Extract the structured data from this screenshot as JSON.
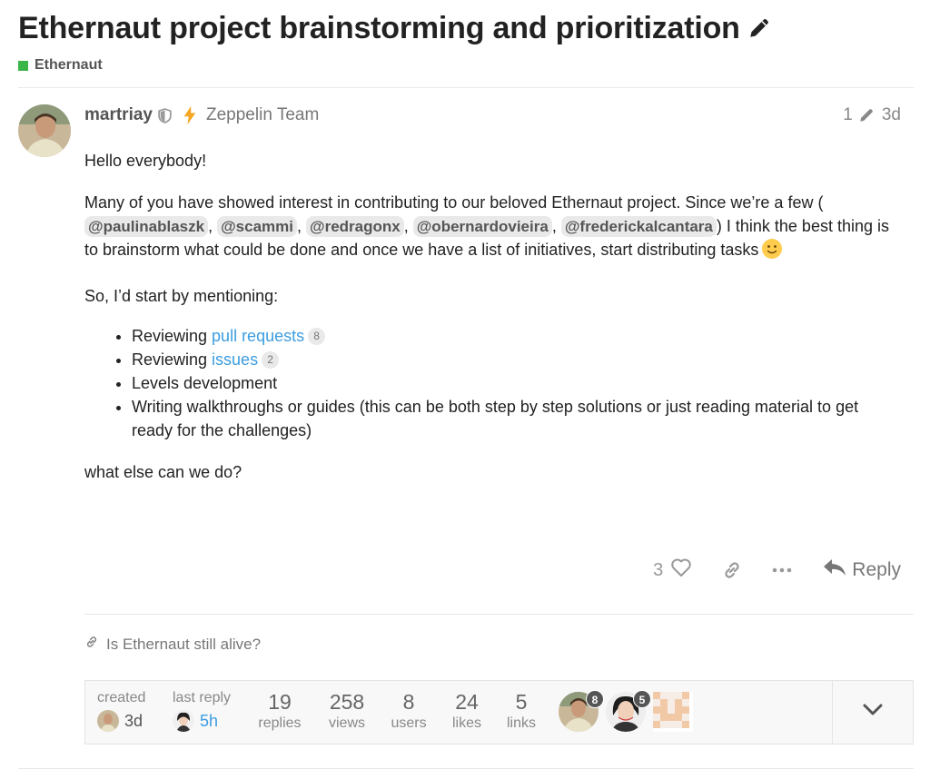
{
  "topic": {
    "title": "Ethernaut project brainstorming and prioritization",
    "category": "Ethernaut",
    "category_color": "#3ab54a"
  },
  "post": {
    "username": "martriay",
    "group": "Zeppelin Team",
    "edit_count": "1",
    "age": "3d",
    "greeting": "Hello everybody!",
    "intro_before": "Many of you have showed interest in contributing to our beloved Ethernaut project. Since we’re a few (",
    "mentions": [
      "@paulinablaszk",
      "@scammi",
      "@redragonx",
      "@obernardovieira",
      "@frederickalcantara"
    ],
    "intro_after": ") I think the best thing is to brainstorm what could be done and once we have a list of initiatives, start distributing tasks",
    "start_text": "So, I’d start by mentioning:",
    "list": [
      {
        "prefix": "Reviewing ",
        "link": "pull requests",
        "count": "8"
      },
      {
        "prefix": "Reviewing ",
        "link": "issues",
        "count": "2"
      },
      {
        "text": "Levels development"
      },
      {
        "text": "Writing walkthroughs or guides (this can be both step by step solutions or just reading material to get ready for the challenges)"
      }
    ],
    "closing": "what else can we do?",
    "likes": "3",
    "reply_label": "Reply"
  },
  "linked_topic": "Is Ethernaut still alive?",
  "summary": {
    "created_label": "created",
    "created_value": "3d",
    "last_reply_label": "last reply",
    "last_reply_value": "5h",
    "stats": [
      {
        "num": "19",
        "label": "replies"
      },
      {
        "num": "258",
        "label": "views"
      },
      {
        "num": "8",
        "label": "users"
      },
      {
        "num": "24",
        "label": "likes"
      },
      {
        "num": "5",
        "label": "links"
      }
    ],
    "participants": [
      {
        "badge": "8"
      },
      {
        "badge": "5"
      },
      {
        "badge": ""
      }
    ]
  },
  "colors": {
    "link": "#3b9de0",
    "accent_flair": "#f5a623"
  }
}
